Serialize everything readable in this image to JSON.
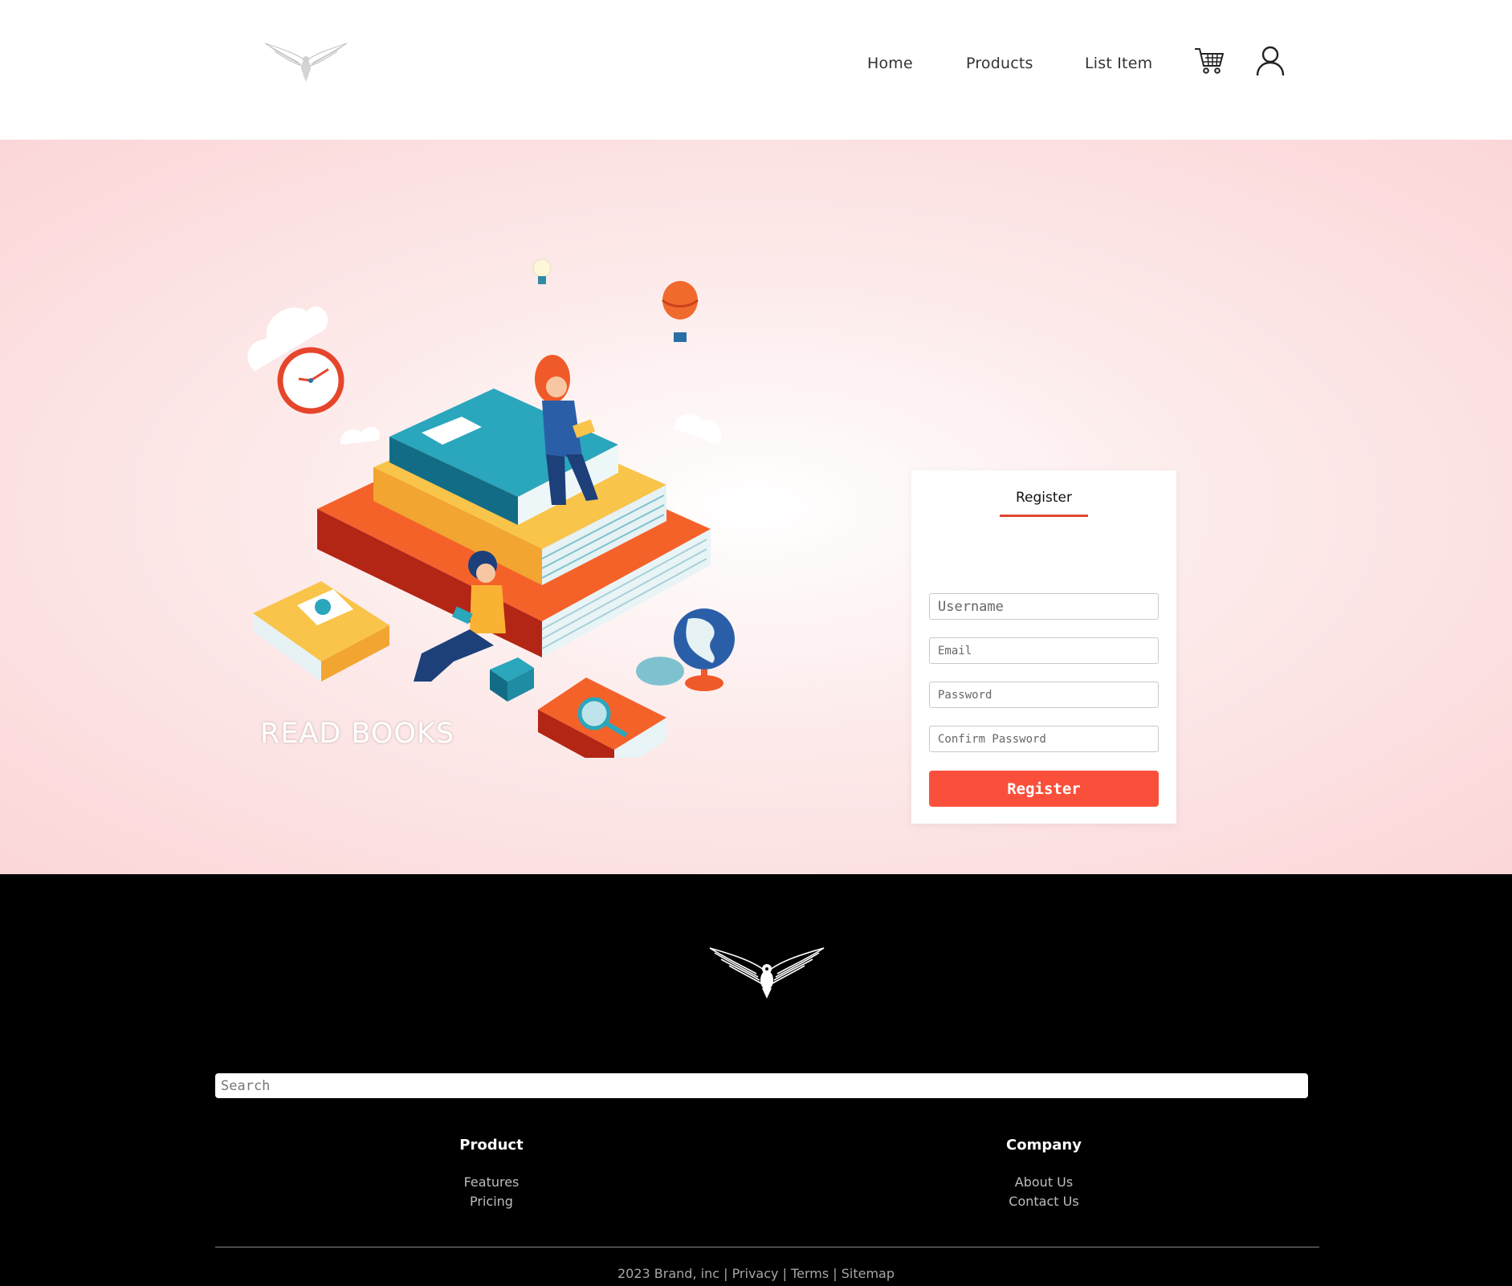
{
  "header": {
    "nav": {
      "home": "Home",
      "products": "Products",
      "list_item": "List Item"
    },
    "icons": {
      "logo": "eagle-logo-icon",
      "cart": "shopping-cart-icon",
      "user": "user-profile-icon"
    }
  },
  "hero": {
    "illustration_caption": "READ BOOKS",
    "background_colors": [
      "#ffffff",
      "#fbd6d8"
    ]
  },
  "register_card": {
    "tab_label": "Register",
    "fields": {
      "username_placeholder": "Username",
      "email_placeholder": "Email",
      "password_placeholder": "Password",
      "confirm_password_placeholder": "Confirm Password"
    },
    "submit_label": "Register",
    "accent_color": "#fa503b"
  },
  "footer": {
    "search_placeholder": "Search",
    "product": {
      "title": "Product",
      "links": [
        "Features",
        "Pricing"
      ]
    },
    "company": {
      "title": "Company",
      "links": [
        "About Us",
        "Contact Us"
      ]
    },
    "copyright": "2023 Brand, inc | Privacy | Terms | Sitemap"
  }
}
